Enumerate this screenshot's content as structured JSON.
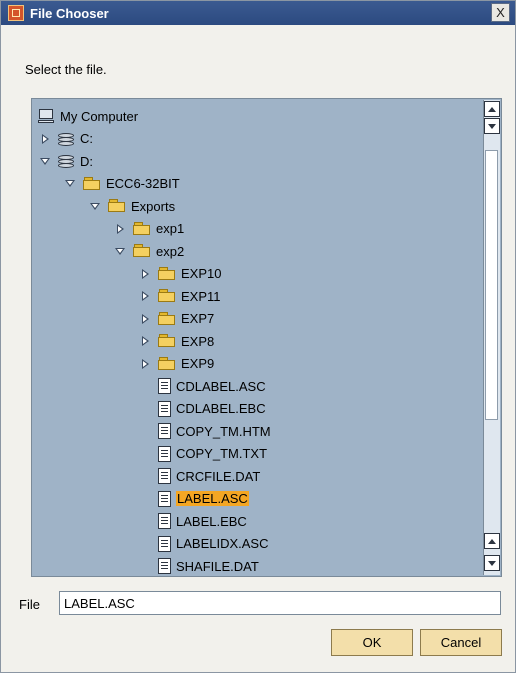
{
  "window": {
    "title": "File Chooser",
    "close_label": "X"
  },
  "prompt": "Select the file.",
  "tree": [
    {
      "label": "My Computer",
      "level": 0,
      "expander": "none",
      "icon": "computer-icon"
    },
    {
      "label": "C:",
      "level": 0,
      "expander": "collapsed",
      "icon": "drive-icon"
    },
    {
      "label": "D:",
      "level": 0,
      "expander": "expanded",
      "icon": "drive-icon"
    },
    {
      "label": "ECC6-32BIT",
      "level": 1,
      "expander": "expanded",
      "icon": "folder-icon"
    },
    {
      "label": "Exports",
      "level": 2,
      "expander": "expanded",
      "icon": "folder-icon"
    },
    {
      "label": "exp1",
      "level": 3,
      "expander": "collapsed",
      "icon": "folder-icon"
    },
    {
      "label": "exp2",
      "level": 3,
      "expander": "expanded",
      "icon": "folder-icon"
    },
    {
      "label": "EXP10",
      "level": 4,
      "expander": "collapsed",
      "icon": "folder-icon"
    },
    {
      "label": "EXP11",
      "level": 4,
      "expander": "collapsed",
      "icon": "folder-icon"
    },
    {
      "label": "EXP7",
      "level": 4,
      "expander": "collapsed",
      "icon": "folder-icon"
    },
    {
      "label": "EXP8",
      "level": 4,
      "expander": "collapsed",
      "icon": "folder-icon"
    },
    {
      "label": "EXP9",
      "level": 4,
      "expander": "collapsed",
      "icon": "folder-icon"
    },
    {
      "label": "CDLABEL.ASC",
      "level": 4,
      "expander": "none",
      "icon": "file-icon"
    },
    {
      "label": "CDLABEL.EBC",
      "level": 4,
      "expander": "none",
      "icon": "file-icon"
    },
    {
      "label": "COPY_TM.HTM",
      "level": 4,
      "expander": "none",
      "icon": "file-icon"
    },
    {
      "label": "COPY_TM.TXT",
      "level": 4,
      "expander": "none",
      "icon": "file-icon"
    },
    {
      "label": "CRCFILE.DAT",
      "level": 4,
      "expander": "none",
      "icon": "file-icon"
    },
    {
      "label": "LABEL.ASC",
      "level": 4,
      "expander": "none",
      "icon": "file-icon",
      "selected": true
    },
    {
      "label": "LABEL.EBC",
      "level": 4,
      "expander": "none",
      "icon": "file-icon"
    },
    {
      "label": "LABELIDX.ASC",
      "level": 4,
      "expander": "none",
      "icon": "file-icon"
    },
    {
      "label": "SHAFILE.DAT",
      "level": 4,
      "expander": "none",
      "icon": "file-icon"
    }
  ],
  "file_field": {
    "label": "File",
    "value": "LABEL.ASC"
  },
  "buttons": {
    "ok": "OK",
    "cancel": "Cancel"
  },
  "colors": {
    "titlebar": "#2c4a80",
    "tree_background": "#9fb3c7",
    "selection": "#f4a623",
    "button": "#f3dfaa"
  }
}
